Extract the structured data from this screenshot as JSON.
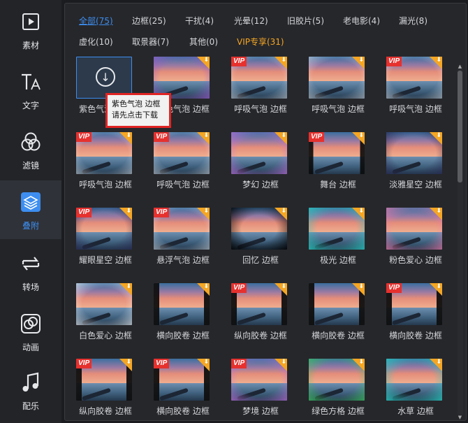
{
  "sidebar": {
    "items": [
      {
        "label": "素材",
        "icon": "play-file-icon",
        "active": false
      },
      {
        "label": "文字",
        "icon": "text-icon",
        "active": false
      },
      {
        "label": "滤镜",
        "icon": "filter-icon",
        "active": false
      },
      {
        "label": "叠附",
        "icon": "layers-icon",
        "active": true
      },
      {
        "label": "转场",
        "icon": "transition-icon",
        "active": false
      },
      {
        "label": "动画",
        "icon": "animation-icon",
        "active": false
      },
      {
        "label": "配乐",
        "icon": "music-icon",
        "active": false
      }
    ],
    "accent": "#3d8ef0"
  },
  "tabs": {
    "row1": [
      {
        "label": "全部(75)",
        "active": true
      },
      {
        "label": "边框(25)"
      },
      {
        "label": "干扰(4)"
      },
      {
        "label": "光晕(12)"
      },
      {
        "label": "旧胶片(5)"
      },
      {
        "label": "老电影(4)"
      },
      {
        "label": "漏光(8)"
      }
    ],
    "row2": [
      {
        "label": "虚化(10)"
      },
      {
        "label": "取景器(7)"
      },
      {
        "label": "其他(0)"
      },
      {
        "label": "VIP专享(31)",
        "vip": true
      }
    ]
  },
  "tooltip": {
    "line1": "紫色气泡 边框",
    "line2": "请先点击下载"
  },
  "items": [
    {
      "name": "紫色气泡 边框",
      "vip": false,
      "selected": true,
      "frame": "purple"
    },
    {
      "name": "紫色气泡 边框",
      "vip": false,
      "frame": "purple"
    },
    {
      "name": "呼吸气泡 边框",
      "vip": true,
      "frame": "bubble"
    },
    {
      "name": "呼吸气泡 边框",
      "vip": false,
      "frame": "bubble"
    },
    {
      "name": "呼吸气泡 边框",
      "vip": true,
      "frame": "bubble"
    },
    {
      "name": "呼吸气泡 边框",
      "vip": true,
      "frame": "bubble"
    },
    {
      "name": "呼吸气泡 边框",
      "vip": true,
      "frame": "bubble"
    },
    {
      "name": "梦幻 边框",
      "vip": false,
      "frame": "dream"
    },
    {
      "name": "舞台 边框",
      "vip": true,
      "frame": "stage"
    },
    {
      "name": "淡雅星空 边框",
      "vip": false,
      "frame": "star"
    },
    {
      "name": "耀眼星空 边框",
      "vip": true,
      "frame": "star"
    },
    {
      "name": "悬浮气泡 边框",
      "vip": true,
      "frame": "bubble"
    },
    {
      "name": "回忆 边框",
      "vip": false,
      "frame": "memory"
    },
    {
      "name": "极光 边框",
      "vip": false,
      "frame": "aurora"
    },
    {
      "name": "粉色爱心 边框",
      "vip": false,
      "frame": "pink"
    },
    {
      "name": "白色爱心 边框",
      "vip": false,
      "frame": "white"
    },
    {
      "name": "横向胶卷 边框",
      "vip": false,
      "frame": "film"
    },
    {
      "name": "纵向胶卷 边框",
      "vip": true,
      "frame": "film"
    },
    {
      "name": "横向胶卷 边框",
      "vip": false,
      "frame": "film"
    },
    {
      "name": "横向胶卷 边框",
      "vip": true,
      "frame": "film"
    },
    {
      "name": "纵向胶卷 边框",
      "vip": true,
      "frame": "film"
    },
    {
      "name": "横向胶卷 边框",
      "vip": true,
      "frame": "film"
    },
    {
      "name": "梦境 边框",
      "vip": true,
      "frame": "dream"
    },
    {
      "name": "绿色方格 边框",
      "vip": false,
      "frame": "green"
    },
    {
      "name": "水草 边框",
      "vip": false,
      "frame": "aurora"
    }
  ],
  "colors": {
    "vip_badge": "#e6312e",
    "download_corner": "#f5a623",
    "tab_vip": "#f5a623",
    "tooltip_border": "#e02424"
  }
}
